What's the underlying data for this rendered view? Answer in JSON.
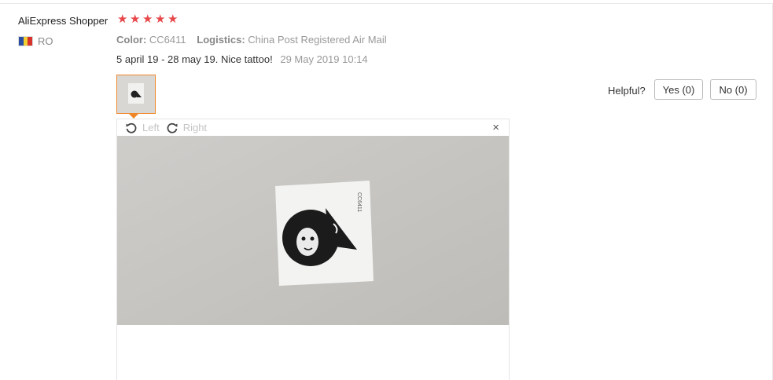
{
  "review": {
    "user_name": "AliExpress Shopper",
    "rating_stars": 5,
    "country_code": "RO",
    "flag_colors": [
      "#2b4ea2",
      "#f2d031",
      "#d7322b"
    ],
    "color_label": "Color:",
    "color_value": "CC6411",
    "logistics_label": "Logistics:",
    "logistics_value": "China Post Registered Air Mail",
    "text": "5 april 19 - 28 may 19. Nice tattoo!",
    "date": "29 May 2019 10:14"
  },
  "helpful": {
    "label": "Helpful?",
    "yes_label": "Yes (0)",
    "no_label": "No (0)"
  },
  "viewer": {
    "rotate_left_label": "Left",
    "rotate_right_label": "Right",
    "close_glyph": "×",
    "tattoo_code": "CC6411"
  },
  "colors": {
    "star": "#e8474a",
    "thumb_border": "#f0862a"
  }
}
